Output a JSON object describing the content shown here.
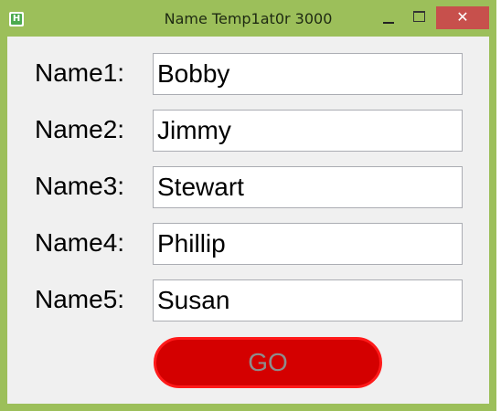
{
  "window": {
    "title": "Name Temp1at0r 3000",
    "app_icon_letter": "H",
    "close_glyph": "✕",
    "colors": {
      "frame": "#9cbf5a",
      "client": "#f0f0f0",
      "close": "#c7504c",
      "go_fill": "#d40000",
      "go_border": "#ff1a1a",
      "go_text": "#8d8d8d"
    }
  },
  "form": {
    "fields": [
      {
        "label": "Name1:",
        "value": "Bobby"
      },
      {
        "label": "Name2:",
        "value": "Jimmy"
      },
      {
        "label": "Name3:",
        "value": "Stewart"
      },
      {
        "label": "Name4:",
        "value": "Phillip"
      },
      {
        "label": "Name5:",
        "value": "Susan"
      }
    ],
    "go_label": "GO"
  }
}
